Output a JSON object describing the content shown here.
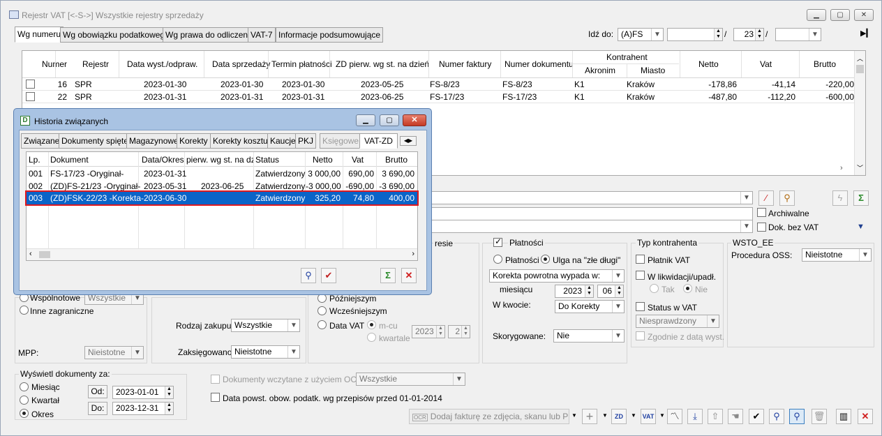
{
  "window": {
    "title": "Rejestr VAT  [<-S->]  Wszystkie rejestry sprzedaży"
  },
  "tabs": [
    "Wg numeru",
    "Wg obowiązku podatkowego",
    "Wg prawa do odliczenia",
    "VAT-7",
    "Informacje podsumowujące"
  ],
  "goto": {
    "label": "Idź do:",
    "value": "(A)FS",
    "num": "23",
    "sep": "/"
  },
  "grid": {
    "headers": {
      "numer": "Numer",
      "rejestr": "Rejestr",
      "data_wyst": "Data wyst./odpraw.",
      "data_sprz": "Data sprzedaży",
      "termin": "Termin płatności",
      "zd": "ZD pierw. wg st. na dzień",
      "nr_faktury": "Numer faktury",
      "nr_dok": "Numer dokumentu",
      "kontrahent": "Kontrahent",
      "akronim": "Akronim",
      "miasto": "Miasto",
      "netto": "Netto",
      "vat": "Vat",
      "brutto": "Brutto"
    },
    "rows": [
      {
        "numer": "16",
        "rejestr": "SPR",
        "data_wyst": "2023-01-30",
        "data_sprz": "2023-01-30",
        "termin": "2023-01-30",
        "zd": "2023-05-25",
        "nr_faktury": "FS-8/23",
        "nr_dok": "FS-8/23",
        "akronim": "K1",
        "miasto": "Kraków",
        "netto": "-178,86",
        "vat": "-41,14",
        "brutto": "-220,00"
      },
      {
        "numer": "22",
        "rejestr": "SPR",
        "data_wyst": "2023-01-31",
        "data_sprz": "2023-01-31",
        "termin": "2023-01-31",
        "zd": "2023-06-25",
        "nr_faktury": "FS-17/23",
        "nr_dok": "FS-17/23",
        "akronim": "K1",
        "miasto": "Kraków",
        "netto": "-487,80",
        "vat": "-112,20",
        "brutto": "-600,00"
      }
    ]
  },
  "filters": {
    "archiwalne": "Archiwalne",
    "dok_bez_vat": "Dok. bez VAT",
    "wspolnotowe": "Wspólnotowe",
    "wspolnotowe_val": "Wszystkie",
    "inne_zagraniczne": "Inne zagraniczne",
    "mpp_label": "MPP:",
    "mpp_val": "Nieistotne",
    "rodzaj_zakupu_label": "Rodzaj zakupu:",
    "rodzaj_zakupu_val": "Wszystkie",
    "zaksiegowano_label": "Zaksięgowano:",
    "zaksiegowano_val": "Nieistotne",
    "okres_group": "resie",
    "pozniejszym": "Późniejszym",
    "wczesniejszym": "Wcześniejszym",
    "data_vat": "Data VAT",
    "m_cu": "m-cu",
    "kwartale": "kwartale",
    "vat_year": "2023",
    "vat_month": "2",
    "platnosci_group": "Płatności",
    "platnosci": "Płatności",
    "ulga": "Ulga na \"złe długi\"",
    "korekta_val": "Korekta powrotna wypada w:",
    "miesiacu": "miesiącu",
    "miesiacu_year": "2023",
    "miesiacu_month": "06",
    "w_kwocie_label": "W kwocie:",
    "w_kwocie_val": "Do Korekty",
    "skorygowane_label": "Skorygowane:",
    "skorygowane_val": "Nie",
    "typ_kontrahenta": "Typ kontrahenta",
    "platnik_vat": "Płatnik VAT",
    "w_likwidacji": "W likwidacji/upadł.",
    "tak": "Tak",
    "nie": "Nie",
    "status_w_vat": "Status w VAT",
    "status_val": "Niesprawdzony",
    "zgodnie": "Zgodnie z datą wyst.",
    "wsto_group": "WSTO_EE",
    "procedura_label": "Procedura OSS:",
    "procedura_val": "Nieistotne"
  },
  "period": {
    "title": "Wyświetl dokumenty za:",
    "miesiac": "Miesiąc",
    "kwartal": "Kwartał",
    "okres": "Okres",
    "od_label": "Od:",
    "od_val": "2023-01-01",
    "do_label": "Do:",
    "do_val": "2023-12-31"
  },
  "ocr": {
    "label": "Dokumenty wczytane z użyciem OCR",
    "val": "Wszystkie",
    "data_powst": "Data powst. obow. podatk. wg przepisów przed 01-01-2014",
    "dodaj": "Dodaj fakturę ze zdjęcia, skanu lub PDF"
  },
  "popup": {
    "title": "Historia związanych",
    "tabs": [
      "Związane",
      "Dokumenty spięte",
      "Magazynowe",
      "Korekty",
      "Korekty kosztu",
      "Kaucje",
      "PKJ",
      "Księgowe",
      "VAT-ZD"
    ],
    "headers": {
      "lp": "Lp.",
      "dokument": "Dokument",
      "data": "Data/Okres",
      "pierw": "pierw. wg st. na dzi",
      "status": "Status",
      "netto": "Netto",
      "vat": "Vat",
      "brutto": "Brutto"
    },
    "rows": [
      {
        "lp": "001",
        "dokument": "FS-17/23 -Oryginał-",
        "data": "2023-01-31",
        "pierw": "",
        "status": "Zatwierdzony",
        "netto": "3 000,00",
        "vat": "690,00",
        "brutto": "3 690,00"
      },
      {
        "lp": "002",
        "dokument": "(ZD)FS-21/23 -Oryginał-",
        "data": "2023-05-31",
        "pierw": "2023-06-25",
        "status": "Zatwierdzony",
        "netto": "-3 000,00",
        "vat": "-690,00",
        "brutto": "-3 690,00"
      },
      {
        "lp": "003",
        "dokument": "(ZD)FSK-22/23 -Korekta-",
        "data": "2023-06-30",
        "pierw": "",
        "status": "Zatwierdzony",
        "netto": "325,20",
        "vat": "74,80",
        "brutto": "400,00"
      }
    ]
  }
}
